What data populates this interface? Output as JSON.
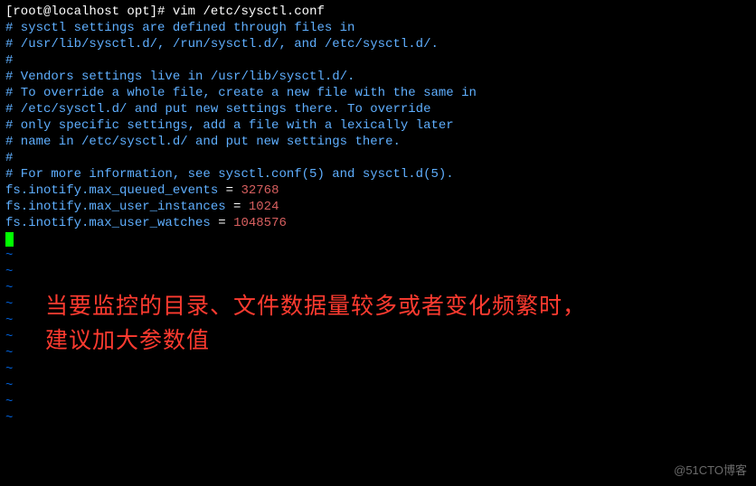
{
  "prompt": {
    "user_host": "[root@localhost opt]# ",
    "command": "vim /etc/sysctl.conf"
  },
  "file_lines": {
    "blank1": "",
    "c1": "# sysctl settings are defined through files in",
    "c2": "# /usr/lib/sysctl.d/, /run/sysctl.d/, and /etc/sysctl.d/.",
    "c3": "#",
    "c4": "# Vendors settings live in /usr/lib/sysctl.d/.",
    "c5": "# To override a whole file, create a new file with the same in",
    "c6": "# /etc/sysctl.d/ and put new settings there. To override",
    "c7": "# only specific settings, add a file with a lexically later",
    "c8": "# name in /etc/sysctl.d/ and put new settings there.",
    "c9": "#",
    "c10": "# For more information, see sysctl.conf(5) and sysctl.d(5)."
  },
  "settings": [
    {
      "key": "fs.inotify.max_queued_events",
      "eq": " = ",
      "value": "32768"
    },
    {
      "key": "fs.inotify.max_user_instances",
      "eq": " = ",
      "value": "1024"
    },
    {
      "key": "fs.inotify.max_user_watches",
      "eq": " = ",
      "value": "1048576"
    }
  ],
  "tilde": "~",
  "tilde_count": 11,
  "annotation": {
    "line1": "当要监控的目录、文件数据量较多或者变化频繁时，",
    "line2": "建议加大参数值"
  },
  "watermark": "@51CTO博客"
}
